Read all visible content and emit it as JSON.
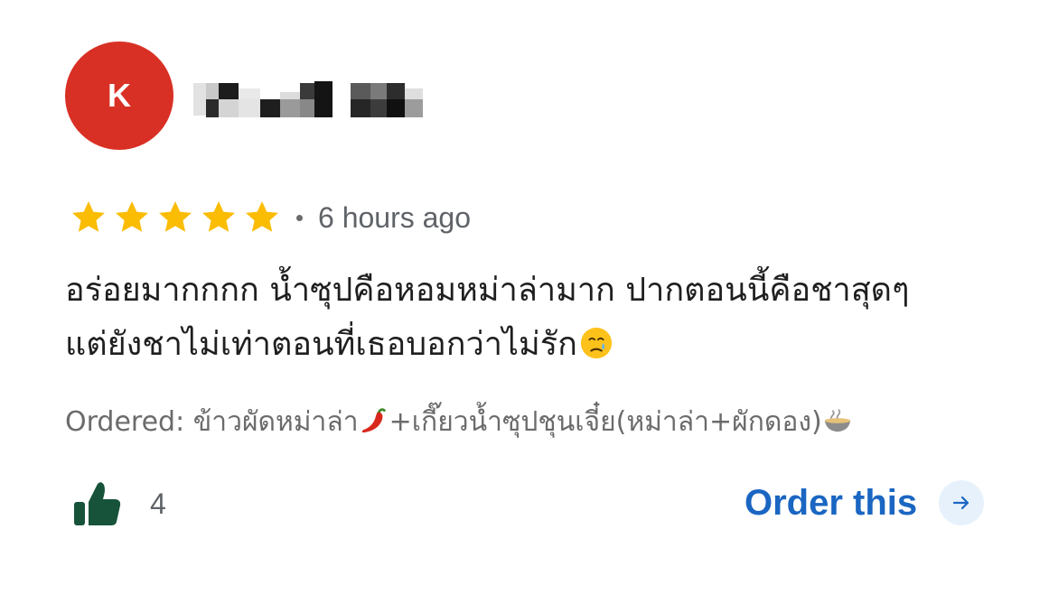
{
  "reviewer": {
    "avatar_letter": "K",
    "avatar_color": "#d93025",
    "name_censored": true
  },
  "rating": {
    "stars": 5,
    "max_stars": 5,
    "star_color": "#fbbc04",
    "time_ago": "6 hours ago"
  },
  "review": {
    "line1": "อร่อยมากกกก น้ำซุปคือหอมหม่าล่ามาก ปากตอนนี้คือชาสุดๆ",
    "line2": "แต่ยังชาไม่เท่าตอนที่เธอบอกว่าไม่รัก",
    "emoji": "sad-tear-face"
  },
  "ordered": {
    "prefix": "Ordered: ",
    "item1": "ข้าวผัดหม่าล่า",
    "item1_icon": "chili-pepper-icon",
    "item2": "+เกี๊ยวน้ำซุปชุนเจี๋ย(หม่าล่า+ผักดอง)",
    "item2_icon": "noodle-bowl-icon"
  },
  "likes": {
    "count": "4",
    "icon": "thumbs-up-icon",
    "icon_color": "#17533a"
  },
  "order_button": {
    "label": "Order this",
    "icon": "arrow-right-icon",
    "color": "#1a66c2"
  }
}
